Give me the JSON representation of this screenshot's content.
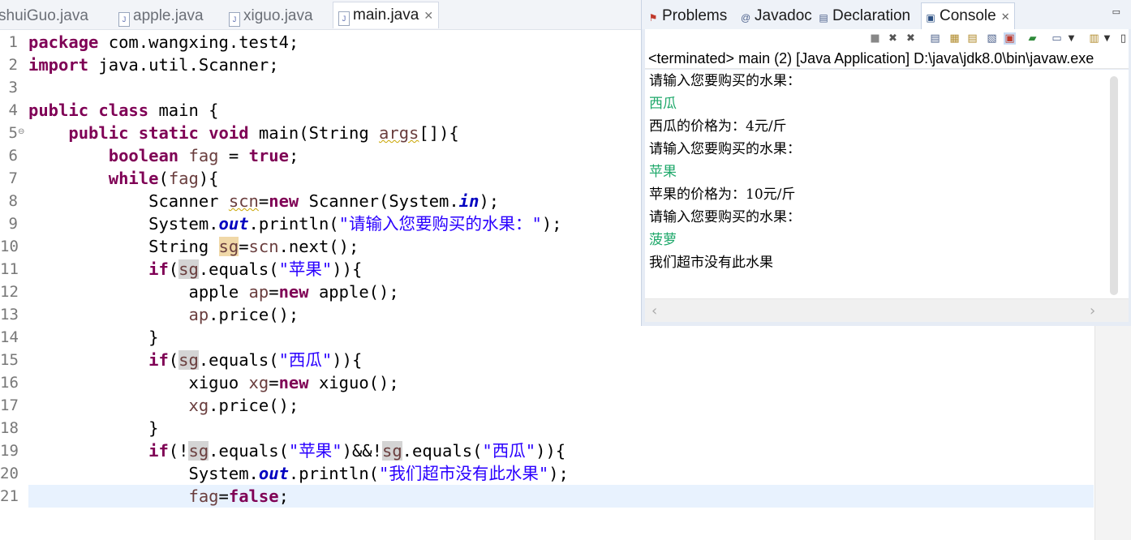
{
  "editor_tabs": [
    {
      "label": "shuiGuo.java"
    },
    {
      "label": "apple.java"
    },
    {
      "label": "xiguo.java"
    },
    {
      "label": "main.java",
      "close": "✕"
    }
  ],
  "line_numbers": [
    "1",
    "2",
    "3",
    "4",
    "5",
    "6",
    "7",
    "8",
    "9",
    "10",
    "11",
    "12",
    "13",
    "14",
    "15",
    "16",
    "17",
    "18",
    "19",
    "20",
    "21"
  ],
  "code": {
    "l1": {
      "kw": "package",
      "rest": " com.wangxing.test4;"
    },
    "l2": {
      "kw": "import",
      "rest": " java.util.Scanner;"
    },
    "l4": {
      "kw1": "public",
      "kw2": "class",
      "rest": " main {"
    },
    "l5": {
      "kw1": "public",
      "kw2": "static",
      "kw3": "void",
      "a": " main(String ",
      "b": "args",
      "c": "[]){"
    },
    "l6": {
      "kw1": "boolean",
      "a": " ",
      "b": "fag",
      "c": " = ",
      "kw2": "true",
      "d": ";"
    },
    "l7": {
      "kw": "while",
      "a": "(",
      "b": "fag",
      "c": "){"
    },
    "l8": {
      "a": "Scanner ",
      "b": "scn",
      "c": "=",
      "kw": "new",
      "d": " Scanner(System.",
      "e": "in",
      "f": ");"
    },
    "l9": {
      "a": "System.",
      "b": "out",
      "c": ".println(",
      "d": "\"请输入您要购买的水果：\"",
      "e": ");"
    },
    "l10": {
      "a": "String ",
      "b": "sg",
      "c": "=",
      "d": "scn",
      "e": ".next();"
    },
    "l11": {
      "kw": "if",
      "a": "(",
      "b": "sg",
      "c": ".equals(",
      "d": "\"苹果\"",
      "e": ")){"
    },
    "l12": {
      "a": "apple ",
      "b": "ap",
      "c": "=",
      "kw": "new",
      "d": " apple();"
    },
    "l13": {
      "a": "ap",
      "b": ".price();"
    },
    "l14": {
      "a": "}"
    },
    "l15": {
      "kw": "if",
      "a": "(",
      "b": "sg",
      "c": ".equals(",
      "d": "\"西瓜\"",
      "e": ")){"
    },
    "l16": {
      "a": "xiguo ",
      "b": "xg",
      "c": "=",
      "kw": "new",
      "d": " xiguo();"
    },
    "l17": {
      "a": "xg",
      "b": ".price();"
    },
    "l18": {
      "a": "}"
    },
    "l19": {
      "kw": "if",
      "a": "(!",
      "b": "sg",
      "c": ".equals(",
      "d": "\"苹果\"",
      "e": ")&&!",
      "f": "sg",
      "g": ".equals(",
      "h": "\"西瓜\"",
      "i": ")){"
    },
    "l20": {
      "a": "System.",
      "b": "out",
      "c": ".println(",
      "d": "\"我们超市没有此水果\"",
      "e": ");"
    },
    "l21": {
      "a": "fag",
      "b": "=",
      "kw": "false",
      "c": ";"
    }
  },
  "view_tabs": [
    {
      "label": "Problems"
    },
    {
      "label": "Javadoc"
    },
    {
      "label": "Declaration"
    },
    {
      "label": "Console",
      "close": "✕"
    }
  ],
  "console": {
    "header": "<terminated> main (2) [Java Application] D:\\java\\jdk8.0\\bin\\javaw.exe",
    "lines": [
      {
        "text": "请输入您要购买的水果："
      },
      {
        "text": "西瓜"
      },
      {
        "text": "西瓜的价格为：4元/斤"
      },
      {
        "text": "请输入您要购买的水果："
      },
      {
        "text": "苹果"
      },
      {
        "text": "苹果的价格为：10元/斤"
      },
      {
        "text": "请输入您要购买的水果："
      },
      {
        "text": "菠萝"
      },
      {
        "text": "我们超市没有此水果"
      }
    ]
  },
  "icons": {
    "java_file": "java-file-icon",
    "problems": "problems-icon",
    "javadoc": "javadoc-icon",
    "declaration": "declaration-icon",
    "console": "console-icon"
  },
  "colors": {
    "keyword": "#7f0055",
    "string": "#2a00ff",
    "static_field": "#0000c0",
    "local_var": "#6a3e3e",
    "console_input": "#1ea86a",
    "current_line": "#e8f2fe"
  }
}
